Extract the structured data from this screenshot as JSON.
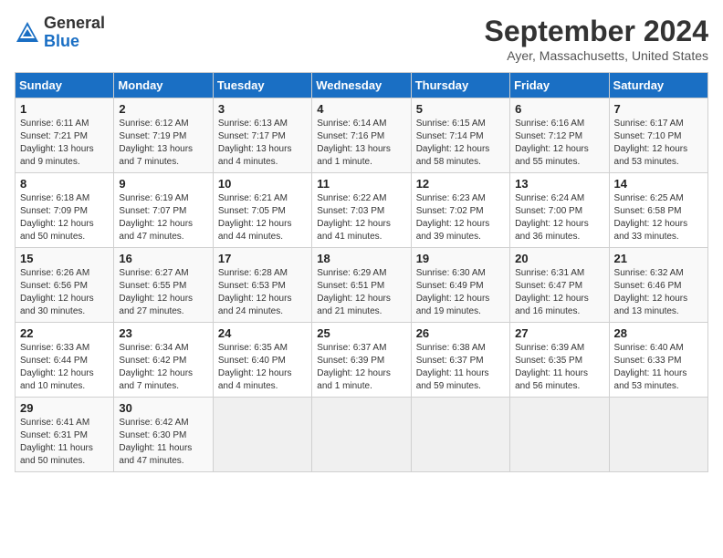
{
  "header": {
    "logo_general": "General",
    "logo_blue": "Blue",
    "month_title": "September 2024",
    "location": "Ayer, Massachusetts, United States"
  },
  "days_of_week": [
    "Sunday",
    "Monday",
    "Tuesday",
    "Wednesday",
    "Thursday",
    "Friday",
    "Saturday"
  ],
  "weeks": [
    [
      {
        "day": 1,
        "info": "Sunrise: 6:11 AM\nSunset: 7:21 PM\nDaylight: 13 hours and 9 minutes."
      },
      {
        "day": 2,
        "info": "Sunrise: 6:12 AM\nSunset: 7:19 PM\nDaylight: 13 hours and 7 minutes."
      },
      {
        "day": 3,
        "info": "Sunrise: 6:13 AM\nSunset: 7:17 PM\nDaylight: 13 hours and 4 minutes."
      },
      {
        "day": 4,
        "info": "Sunrise: 6:14 AM\nSunset: 7:16 PM\nDaylight: 13 hours and 1 minute."
      },
      {
        "day": 5,
        "info": "Sunrise: 6:15 AM\nSunset: 7:14 PM\nDaylight: 12 hours and 58 minutes."
      },
      {
        "day": 6,
        "info": "Sunrise: 6:16 AM\nSunset: 7:12 PM\nDaylight: 12 hours and 55 minutes."
      },
      {
        "day": 7,
        "info": "Sunrise: 6:17 AM\nSunset: 7:10 PM\nDaylight: 12 hours and 53 minutes."
      }
    ],
    [
      {
        "day": 8,
        "info": "Sunrise: 6:18 AM\nSunset: 7:09 PM\nDaylight: 12 hours and 50 minutes."
      },
      {
        "day": 9,
        "info": "Sunrise: 6:19 AM\nSunset: 7:07 PM\nDaylight: 12 hours and 47 minutes."
      },
      {
        "day": 10,
        "info": "Sunrise: 6:21 AM\nSunset: 7:05 PM\nDaylight: 12 hours and 44 minutes."
      },
      {
        "day": 11,
        "info": "Sunrise: 6:22 AM\nSunset: 7:03 PM\nDaylight: 12 hours and 41 minutes."
      },
      {
        "day": 12,
        "info": "Sunrise: 6:23 AM\nSunset: 7:02 PM\nDaylight: 12 hours and 39 minutes."
      },
      {
        "day": 13,
        "info": "Sunrise: 6:24 AM\nSunset: 7:00 PM\nDaylight: 12 hours and 36 minutes."
      },
      {
        "day": 14,
        "info": "Sunrise: 6:25 AM\nSunset: 6:58 PM\nDaylight: 12 hours and 33 minutes."
      }
    ],
    [
      {
        "day": 15,
        "info": "Sunrise: 6:26 AM\nSunset: 6:56 PM\nDaylight: 12 hours and 30 minutes."
      },
      {
        "day": 16,
        "info": "Sunrise: 6:27 AM\nSunset: 6:55 PM\nDaylight: 12 hours and 27 minutes."
      },
      {
        "day": 17,
        "info": "Sunrise: 6:28 AM\nSunset: 6:53 PM\nDaylight: 12 hours and 24 minutes."
      },
      {
        "day": 18,
        "info": "Sunrise: 6:29 AM\nSunset: 6:51 PM\nDaylight: 12 hours and 21 minutes."
      },
      {
        "day": 19,
        "info": "Sunrise: 6:30 AM\nSunset: 6:49 PM\nDaylight: 12 hours and 19 minutes."
      },
      {
        "day": 20,
        "info": "Sunrise: 6:31 AM\nSunset: 6:47 PM\nDaylight: 12 hours and 16 minutes."
      },
      {
        "day": 21,
        "info": "Sunrise: 6:32 AM\nSunset: 6:46 PM\nDaylight: 12 hours and 13 minutes."
      }
    ],
    [
      {
        "day": 22,
        "info": "Sunrise: 6:33 AM\nSunset: 6:44 PM\nDaylight: 12 hours and 10 minutes."
      },
      {
        "day": 23,
        "info": "Sunrise: 6:34 AM\nSunset: 6:42 PM\nDaylight: 12 hours and 7 minutes."
      },
      {
        "day": 24,
        "info": "Sunrise: 6:35 AM\nSunset: 6:40 PM\nDaylight: 12 hours and 4 minutes."
      },
      {
        "day": 25,
        "info": "Sunrise: 6:37 AM\nSunset: 6:39 PM\nDaylight: 12 hours and 1 minute."
      },
      {
        "day": 26,
        "info": "Sunrise: 6:38 AM\nSunset: 6:37 PM\nDaylight: 11 hours and 59 minutes."
      },
      {
        "day": 27,
        "info": "Sunrise: 6:39 AM\nSunset: 6:35 PM\nDaylight: 11 hours and 56 minutes."
      },
      {
        "day": 28,
        "info": "Sunrise: 6:40 AM\nSunset: 6:33 PM\nDaylight: 11 hours and 53 minutes."
      }
    ],
    [
      {
        "day": 29,
        "info": "Sunrise: 6:41 AM\nSunset: 6:31 PM\nDaylight: 11 hours and 50 minutes."
      },
      {
        "day": 30,
        "info": "Sunrise: 6:42 AM\nSunset: 6:30 PM\nDaylight: 11 hours and 47 minutes."
      },
      null,
      null,
      null,
      null,
      null
    ]
  ]
}
